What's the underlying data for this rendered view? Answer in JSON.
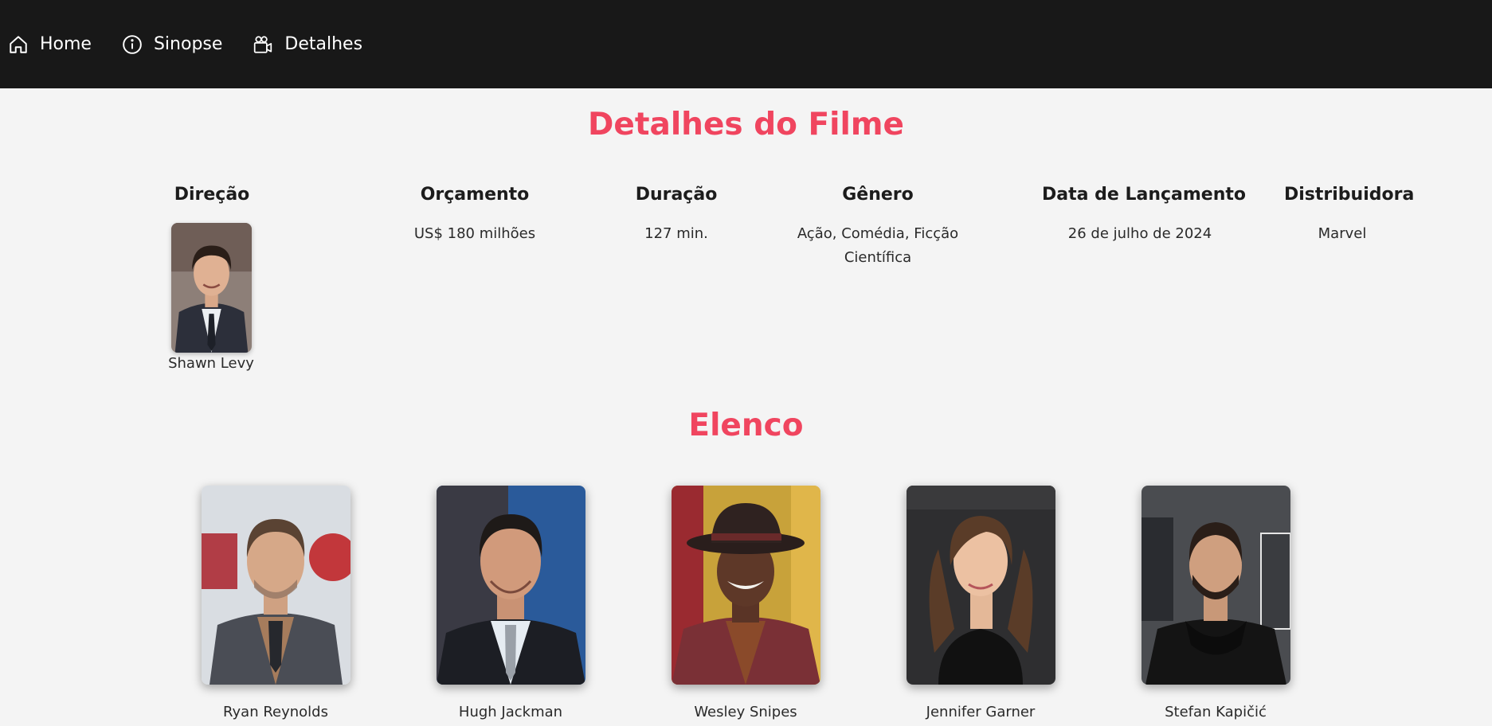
{
  "nav": {
    "items": [
      {
        "label": "Home",
        "icon": "home-icon"
      },
      {
        "label": "Sinopse",
        "icon": "info-icon"
      },
      {
        "label": "Detalhes",
        "icon": "video-camera-icon"
      }
    ]
  },
  "details": {
    "title": "Detalhes do Filme",
    "direction": {
      "heading": "Direção",
      "name": "Shawn Levy"
    },
    "budget": {
      "heading": "Orçamento",
      "value": "US$ 180 milhões"
    },
    "duration": {
      "heading": "Duração",
      "value": "127 min."
    },
    "genre": {
      "heading": "Gênero",
      "value": "Ação, Comédia, Ficção Científica"
    },
    "release": {
      "heading": "Data de Lançamento",
      "value": "26 de julho de 2024"
    },
    "distributor": {
      "heading": "Distribuidora",
      "value": "Marvel"
    }
  },
  "cast": {
    "title": "Elenco",
    "members": [
      {
        "name": "Ryan Reynolds"
      },
      {
        "name": "Hugh Jackman"
      },
      {
        "name": "Wesley Snipes"
      },
      {
        "name": "Jennifer Garner"
      },
      {
        "name": "Stefan Kapičić"
      }
    ]
  },
  "colors": {
    "nav_bg": "#181818",
    "accent": "#f0455f",
    "page_bg": "#f4f4f4"
  }
}
